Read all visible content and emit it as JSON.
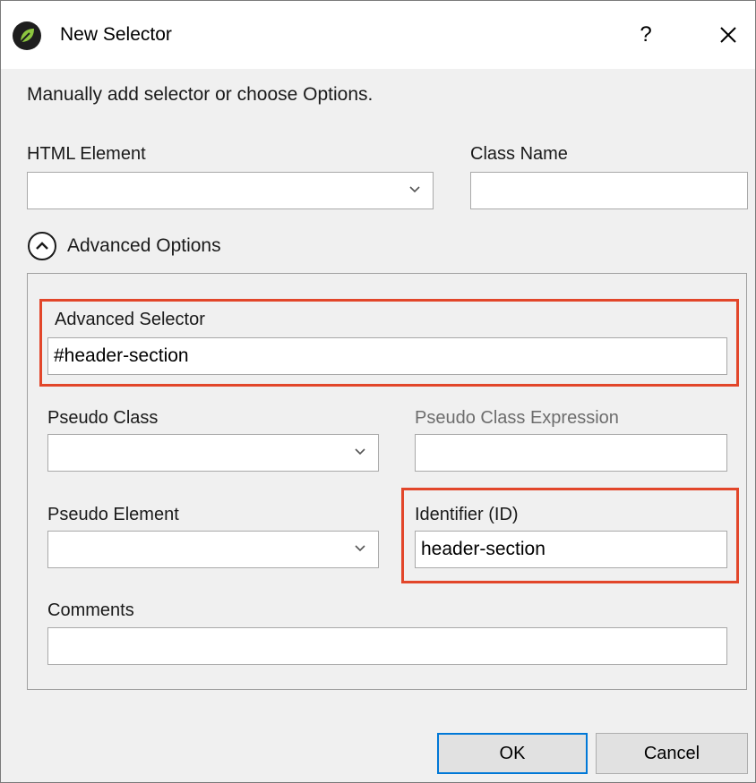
{
  "window": {
    "title": "New Selector",
    "help_label": "?",
    "icons": {
      "app": "leaf-logo-icon",
      "close": "close-icon"
    }
  },
  "instructions": "Manually add selector or choose Options.",
  "basic": {
    "html_element_label": "HTML Element",
    "html_element_value": "",
    "class_name_label": "Class Name",
    "class_name_value": ""
  },
  "advanced": {
    "toggle_label": "Advanced Options",
    "toggle_icon": "chevron-up-circle-icon",
    "advanced_selector_label": "Advanced Selector",
    "advanced_selector_value": "#header-section",
    "pseudo_class_label": "Pseudo Class",
    "pseudo_class_value": "",
    "pseudo_class_expression_label": "Pseudo Class Expression",
    "pseudo_class_expression_value": "",
    "pseudo_element_label": "Pseudo Element",
    "pseudo_element_value": "",
    "identifier_label": "Identifier (ID)",
    "identifier_value": "header-section",
    "comments_label": "Comments",
    "comments_value": ""
  },
  "buttons": {
    "ok": "OK",
    "cancel": "Cancel"
  },
  "colors": {
    "highlight": "#e2462a",
    "default_button_border": "#0078d7"
  }
}
